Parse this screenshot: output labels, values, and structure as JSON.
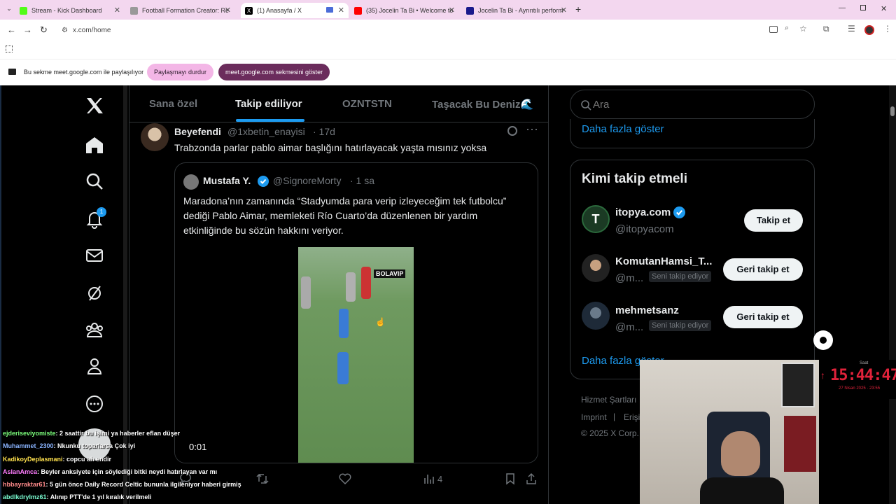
{
  "tabs": [
    {
      "title": "Stream - Kick Dashboard",
      "color": "#53fc18"
    },
    {
      "title": "Football Formation Creator: Re",
      "color": "#777"
    },
    {
      "title": "(1) Anasayfa / X",
      "color": "#000"
    },
    {
      "title": "(35) Jocelin Ta Bi • Welcome to",
      "color": "#ff0000"
    },
    {
      "title": "Jocelin Ta Bi - Ayrıntılı perform",
      "color": "#1a1a8c"
    }
  ],
  "address": {
    "url": "x.com/home"
  },
  "sharing": {
    "text": "Bu sekme meet.google.com ile paylaşılıyor",
    "stop_label": "Paylaşmayı durdur",
    "show_label": "meet.google.com sekmesini göster"
  },
  "nav": {
    "notification_count": "1"
  },
  "feed_tabs": [
    "Sana özel",
    "Takip ediliyor",
    "OZNTSTN",
    "Taşacak Bu Deniz🌊"
  ],
  "tweet": {
    "name": "Beyefendi",
    "handle": "@1xbetin_enayisi",
    "time": "· 17d",
    "text": "Trabzonda parlar pablo aimar başlığını hatırlayacak yaşta mısınız yoksa",
    "quote": {
      "name": "Mustafa Y.",
      "handle": "@SignoreMorty",
      "time": "· 1 sa",
      "text": "Maradona’nın zamanında “Stadyumda para verip izleyeceğim tek futbolcu” dediği Pablo Aimar, memleketi Río Cuarto’da düzenlenen bir yardım etkinliğinde bu sözün hakkını veriyor.",
      "video_time": "0:01",
      "watermark": "BOLAVIP"
    },
    "views": "4"
  },
  "search": {
    "placeholder": "Ara"
  },
  "show_more_top": "Daha fazla göster",
  "who_to_follow": {
    "title": "Kimi takip etmeli",
    "accounts": [
      {
        "name": "itopya.com",
        "handle": "@itopyacom",
        "badge": "",
        "button": "Takip et"
      },
      {
        "name": "KomutanHamsi_T...",
        "handle": "@m...",
        "badge": "Seni takip ediyor",
        "button": "Geri takip et"
      },
      {
        "name": "mehmetsanz",
        "handle": "@m...",
        "badge": "Seni takip ediyor",
        "button": "Geri takip et"
      }
    ],
    "show_more": "Daha fazla göster"
  },
  "footer": {
    "terms": "Hizmet Şartları",
    "imprint": "Imprint",
    "access": "Erişi",
    "copyright": "© 2025 X Corp."
  },
  "overlay": {
    "clock": "15:44:47",
    "clock_label": "Saat",
    "date": "27 Nisan 2025 · 23:55"
  },
  "chat": [
    {
      "user": "ejderiseviyomiste",
      "color": "#7cff7c",
      "msg": ": 2 saattir bu işimi ya haberler eflan düşer"
    },
    {
      "user": "Muhammet_2300",
      "color": "#8ab4ff",
      "msg": ": Nkunku toparlarsa Çok iyi"
    },
    {
      "user": "KadikoyDeplasmani",
      "color": "#ffe14d",
      "msg": ": copcu ah endir"
    },
    {
      "user": "AslanAmca",
      "color": "#ff7cff",
      "msg": ": Beyler anksiyete için söylediği bitki neydi hatırlayan var mı"
    },
    {
      "user": "hbbayraktar61",
      "color": "#ff8a8a",
      "msg": ": 5 gün önce Daily Record Celtic bununla ilgileniyor haberi girmiş"
    },
    {
      "user": "abdlkdrylmz61",
      "color": "#7cffd4",
      "msg": ": Alınıp PTT'de 1 yıl kıralık verilmeli"
    }
  ]
}
